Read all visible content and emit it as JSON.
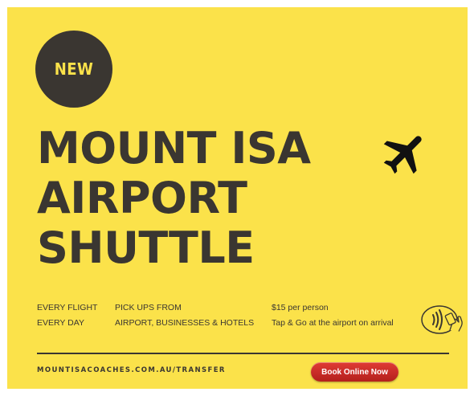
{
  "badge": {
    "label": "NEW"
  },
  "title": {
    "line1": "MOUNT ISA",
    "line2": "AIRPORT",
    "line3": "SHUTTLE"
  },
  "info": {
    "col1": [
      "EVERY FLIGHT",
      "EVERY DAY"
    ],
    "col2": [
      "PICK UPS FROM",
      "AIRPORT, BUSINESSES & HOTELS"
    ],
    "col3": [
      "$15 per person",
      "Tap & Go at the airport on arrival"
    ]
  },
  "footer": {
    "url": "MOUNTISACOACHES.COM.AU/TRANSFER",
    "book_label": "Book Online Now"
  },
  "icons": {
    "plane": "airplane-icon",
    "payment": "contactless-payment-icon"
  },
  "colors": {
    "background": "#fbe24a",
    "text": "#3a3631",
    "button": "#c62a25",
    "button_text": "#ffffff"
  }
}
